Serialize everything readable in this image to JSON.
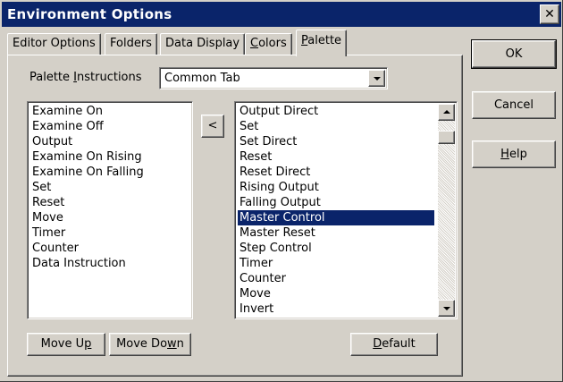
{
  "window": {
    "title": "Environment Options",
    "close_label": "✕"
  },
  "tabs": [
    {
      "label": "Editor Options",
      "mnemonic": ""
    },
    {
      "label": "Folders",
      "mnemonic": ""
    },
    {
      "label": "Data Display",
      "mnemonic": ""
    },
    {
      "pre": "",
      "mnemonic": "C",
      "post": "olors"
    },
    {
      "pre": "",
      "mnemonic": "P",
      "post": "alette"
    }
  ],
  "active_tab": "Palette",
  "palette": {
    "instructions_label": {
      "pre": "Palette ",
      "mnemonic": "I",
      "post": "nstructions"
    },
    "combo_value": "Common Tab",
    "available_list": [
      "Examine On",
      "Examine Off",
      "Output",
      "Examine On Rising",
      "Examine On Falling",
      "Set",
      "Reset",
      "Move",
      "Timer",
      "Counter",
      "Data Instruction"
    ],
    "move_left_label": "<",
    "tab_list": [
      "Output Direct",
      "Set",
      "Set Direct",
      "Reset",
      "Reset Direct",
      "Rising Output",
      "Falling Output",
      "Master Control",
      "Master Reset",
      "Step Control",
      "Timer",
      "Counter",
      "Move",
      "Invert"
    ],
    "selected_item": "Master Control",
    "move_up": {
      "pre": "Move U",
      "mnemonic": "p",
      "post": ""
    },
    "move_down": {
      "pre": "Move Do",
      "mnemonic": "w",
      "post": "n"
    },
    "default": {
      "pre": "",
      "mnemonic": "D",
      "post": "efault"
    }
  },
  "buttons": {
    "ok": "OK",
    "cancel": "Cancel",
    "help": {
      "pre": "",
      "mnemonic": "H",
      "post": "elp"
    }
  },
  "colors": {
    "titlebar": "#0a246a",
    "face": "#d4d0c8",
    "selection": "#0a246a"
  }
}
